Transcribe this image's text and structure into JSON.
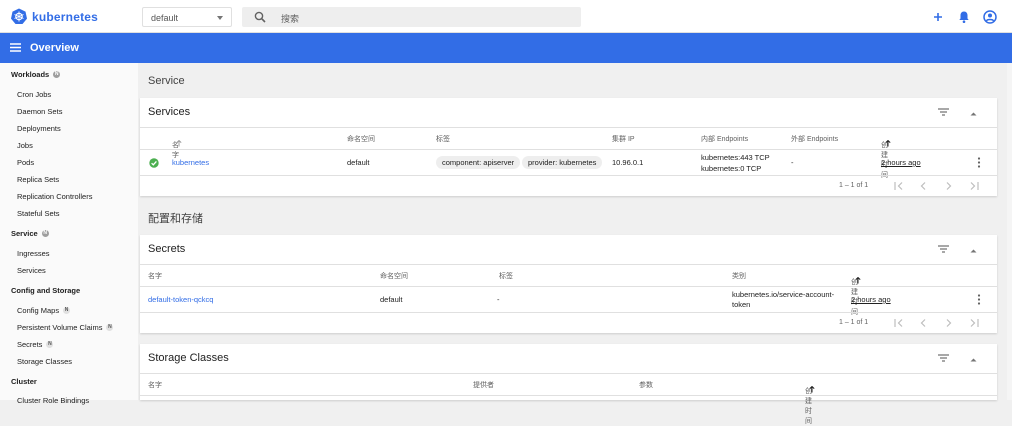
{
  "app": {
    "brand": "kubernetes",
    "namespace": "default",
    "search_placeholder": "搜索"
  },
  "header": {
    "title": "Overview"
  },
  "colors": {
    "brand_blue": "#326de6",
    "success_green": "#4caf50"
  },
  "sidebar": {
    "workloads": {
      "label": "Workloads",
      "badge": "N"
    },
    "workload_items": [
      "Cron Jobs",
      "Daemon Sets",
      "Deployments",
      "Jobs",
      "Pods",
      "Replica Sets",
      "Replication Controllers",
      "Stateful Sets"
    ],
    "service": {
      "label": "Service",
      "badge": "N"
    },
    "service_items": [
      "Ingresses",
      "Services"
    ],
    "config": {
      "label": "Config and Storage"
    },
    "config_items": [
      {
        "label": "Config Maps",
        "badge": "N"
      },
      {
        "label": "Persistent Volume Claims",
        "badge": "N"
      },
      {
        "label": "Secrets",
        "badge": "N"
      },
      {
        "label": "Storage Classes"
      }
    ],
    "cluster": {
      "label": "Cluster"
    },
    "cluster_items": [
      "Cluster Role Bindings"
    ]
  },
  "service_section": {
    "title": "Service"
  },
  "services_card": {
    "title": "Services",
    "headers": [
      "名字",
      "命名空间",
      "标签",
      "集群 IP",
      "内部 Endpoints",
      "外部 Endpoints",
      "创建时间"
    ],
    "row": {
      "name": "kubernetes",
      "namespace": "default",
      "labels": [
        "component: apiserver",
        "provider: kubernetes"
      ],
      "cluster_ip": "10.96.0.1",
      "internal_endpoints": [
        "kubernetes:443 TCP",
        "kubernetes:0 TCP"
      ],
      "external_endpoints": "-",
      "created": "2 hours ago"
    },
    "pagination": "1 – 1 of 1"
  },
  "config_section": {
    "title": "配置和存储"
  },
  "secrets_card": {
    "title": "Secrets",
    "headers": [
      "名字",
      "命名空间",
      "标签",
      "类别",
      "创建时间"
    ],
    "row": {
      "name": "default-token-qckcq",
      "namespace": "default",
      "labels": "-",
      "type_line1": "kubernetes.io/service-account-",
      "type_line2": "token",
      "created": "2 hours ago"
    },
    "pagination": "1 – 1 of 1"
  },
  "storage_card": {
    "title": "Storage Classes",
    "headers": [
      "名字",
      "提供者",
      "参数",
      "创建时间"
    ]
  }
}
